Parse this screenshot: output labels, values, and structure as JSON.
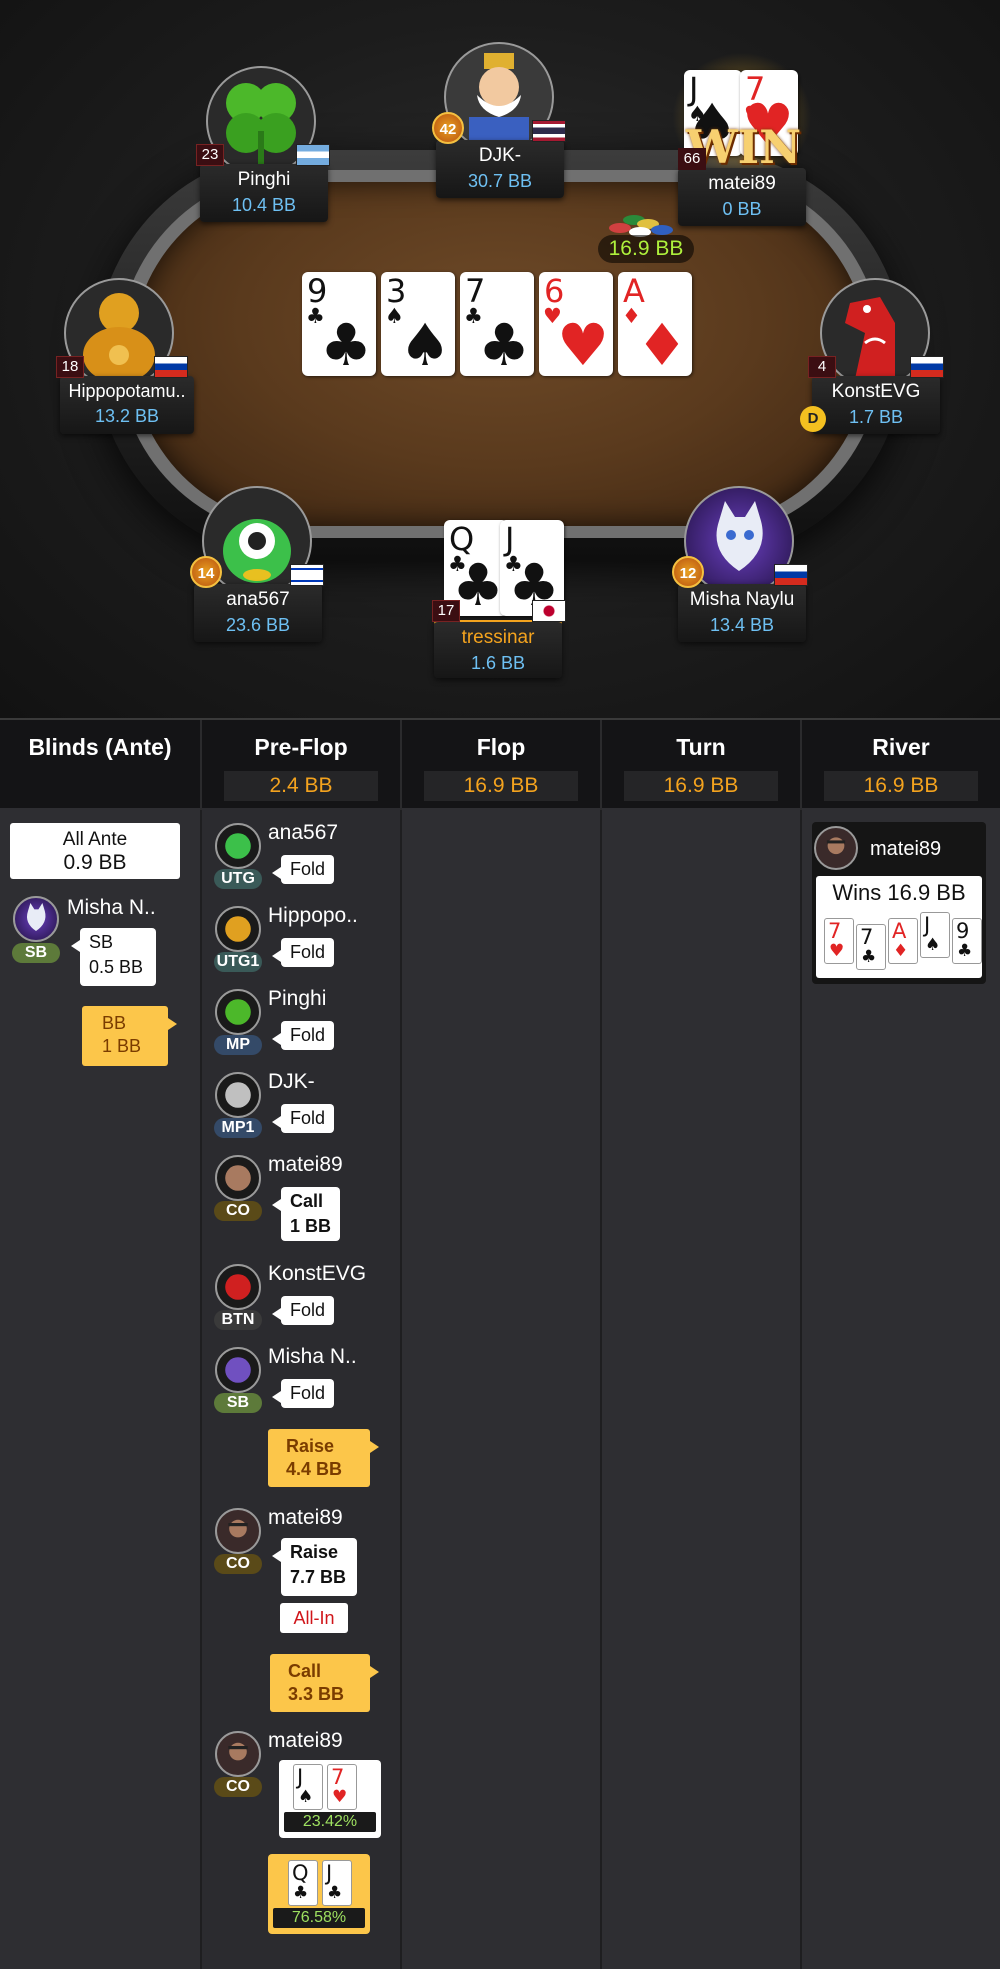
{
  "pot": "16.9 BB",
  "board": [
    {
      "rank": "9",
      "suit": "♣",
      "color": "black"
    },
    {
      "rank": "3",
      "suit": "♠",
      "color": "black"
    },
    {
      "rank": "7",
      "suit": "♣",
      "color": "black"
    },
    {
      "rank": "6",
      "suit": "♥",
      "color": "red"
    },
    {
      "rank": "A",
      "suit": "♦",
      "color": "red"
    }
  ],
  "players": {
    "pinghi": {
      "name": "Pinghi",
      "stack": "10.4 BB",
      "level": "23",
      "flag": "argentina",
      "avatar": "clover-icon"
    },
    "djk": {
      "name": "DJK-",
      "stack": "30.7 BB",
      "level": "42",
      "flag": "thailand",
      "avatar": "king-icon"
    },
    "matei": {
      "name": "matei89",
      "stack": "0 BB",
      "level": "66",
      "badge": "WIN",
      "cards": [
        {
          "rank": "J",
          "suit": "♠",
          "color": "black"
        },
        {
          "rank": "7",
          "suit": "♥",
          "color": "red"
        }
      ]
    },
    "hippo": {
      "name": "Hippopotamu..",
      "stack": "13.2 BB",
      "level": "18",
      "flag": "russia",
      "avatar": "buddha-icon"
    },
    "konst": {
      "name": "KonstEVG",
      "stack": "1.7 BB",
      "level": "4",
      "flag": "russia",
      "dealer": "D",
      "avatar": "horse-icon"
    },
    "ana": {
      "name": "ana567",
      "stack": "23.6 BB",
      "level": "14",
      "flag": "israel",
      "avatar": "monster-icon"
    },
    "tress": {
      "name": "tressinar",
      "stack": "1.6 BB",
      "level": "17",
      "flag": "japan",
      "cards": [
        {
          "rank": "Q",
          "suit": "♣",
          "color": "black"
        },
        {
          "rank": "J",
          "suit": "♣",
          "color": "black"
        }
      ]
    },
    "misha": {
      "name": "Misha Naylu",
      "stack": "13.4 BB",
      "level": "12",
      "flag": "russia",
      "avatar": "cat-icon"
    }
  },
  "headers": [
    {
      "title": "Blinds (Ante)",
      "value": ""
    },
    {
      "title": "Pre-Flop",
      "value": "2.4 BB"
    },
    {
      "title": "Flop",
      "value": "16.9 BB"
    },
    {
      "title": "Turn",
      "value": "16.9 BB"
    },
    {
      "title": "River",
      "value": "16.9 BB"
    }
  ],
  "blinds": {
    "ante_label": "All Ante",
    "ante_value": "0.9 BB",
    "sb_player": "Misha N..",
    "sb_pos": "SB",
    "sb_label": "SB",
    "sb_value": "0.5 BB",
    "bb_label": "BB",
    "bb_value": "1 BB"
  },
  "preflop": [
    {
      "name": "ana567",
      "pos": "UTG",
      "action": "Fold"
    },
    {
      "name": "Hippopo..",
      "pos": "UTG1",
      "action": "Fold"
    },
    {
      "name": "Pinghi",
      "pos": "MP",
      "action": "Fold"
    },
    {
      "name": "DJK-",
      "pos": "MP1",
      "action": "Fold"
    },
    {
      "name": "matei89",
      "pos": "CO",
      "action": "Call",
      "amount": "1 BB"
    },
    {
      "name": "KonstEVG",
      "pos": "BTN",
      "action": "Fold"
    },
    {
      "name": "Misha N..",
      "pos": "SB",
      "action": "Fold"
    }
  ],
  "hero_raise": {
    "action": "Raise",
    "amount": "4.4 BB"
  },
  "reraise": {
    "name": "matei89",
    "pos": "CO",
    "action": "Raise",
    "amount": "7.7 BB",
    "tag": "All-In"
  },
  "hero_call": {
    "action": "Call",
    "amount": "3.3 BB"
  },
  "showdown": {
    "name": "matei89",
    "pos": "CO",
    "equity": "23.42%",
    "hero_equity": "76.58%",
    "cards": [
      {
        "rank": "J",
        "suit": "♠",
        "color": "black"
      },
      {
        "rank": "7",
        "suit": "♥",
        "color": "red"
      }
    ],
    "hero_cards": [
      {
        "rank": "Q",
        "suit": "♣",
        "color": "black"
      },
      {
        "rank": "J",
        "suit": "♣",
        "color": "black"
      }
    ]
  },
  "river": {
    "name": "matei89",
    "result": "Wins 16.9 BB",
    "cards": [
      {
        "rank": "7",
        "suit": "♥",
        "color": "red"
      },
      {
        "rank": "7",
        "suit": "♣",
        "color": "black"
      },
      {
        "rank": "A",
        "suit": "♦",
        "color": "red"
      },
      {
        "rank": "J",
        "suit": "♠",
        "color": "black"
      },
      {
        "rank": "9",
        "suit": "♣",
        "color": "black"
      }
    ]
  },
  "colors": {
    "accent": "#f4a31e",
    "stack": "#6ec0f3",
    "gold": "#fcc64a",
    "allin": "#d0151a"
  }
}
